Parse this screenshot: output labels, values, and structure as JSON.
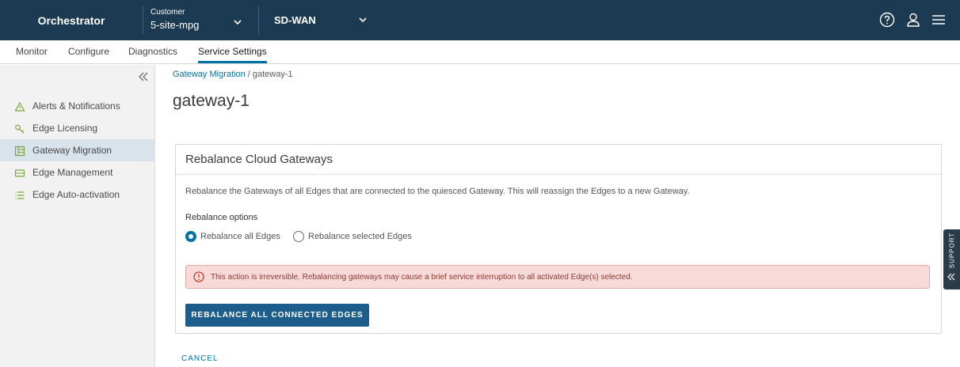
{
  "topbar": {
    "brand": "Orchestrator",
    "customer_label": "Customer",
    "customer_value": "5-site-mpg",
    "product": "SD-WAN",
    "icons": [
      "help-icon",
      "user-icon",
      "menu-icon"
    ]
  },
  "tabs": [
    {
      "label": "Monitor"
    },
    {
      "label": "Configure"
    },
    {
      "label": "Diagnostics"
    },
    {
      "label": "Service Settings",
      "active": true
    }
  ],
  "sidebar": {
    "items": [
      {
        "label": "Alerts & Notifications",
        "icon": "alert-triangle-icon"
      },
      {
        "label": "Edge Licensing",
        "icon": "key-icon"
      },
      {
        "label": "Gateway Migration",
        "icon": "gateway-icon",
        "active": true
      },
      {
        "label": "Edge Management",
        "icon": "edge-device-icon"
      },
      {
        "label": "Edge Auto-activation",
        "icon": "list-icon"
      }
    ]
  },
  "breadcrumb": {
    "link": "Gateway Migration",
    "separator": " / ",
    "current": "gateway-1"
  },
  "page_title": "gateway-1",
  "card": {
    "title": "Rebalance Cloud Gateways",
    "description": "Rebalance the Gateways of all Edges that are connected to the quiesced Gateway. This will reassign the Edges to a new Gateway.",
    "options_label": "Rebalance options",
    "options": [
      {
        "label": "Rebalance all Edges",
        "checked": true
      },
      {
        "label": "Rebalance selected Edges",
        "checked": false
      }
    ],
    "alert": "This action is irreversible. Rebalancing gateways may cause a brief service interruption to all activated Edge(s) selected.",
    "primary_button": "REBALANCE ALL CONNECTED EDGES"
  },
  "cancel_label": "CANCEL",
  "support_label": "SUPPORT",
  "colors": {
    "topbar": "#1c3a52",
    "accent": "#0072a3",
    "primary_button": "#1c5d8c",
    "alert_bg": "#f8dbd9",
    "alert_text": "#8a3a33"
  }
}
